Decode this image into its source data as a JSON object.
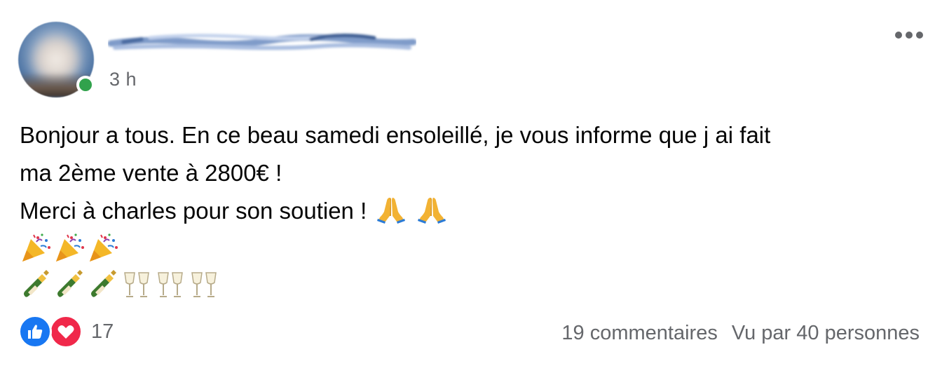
{
  "post": {
    "author": {
      "name_redacted": true,
      "online": true
    },
    "timestamp": "3 h",
    "more_icon": "more-horizontal-icon",
    "body": {
      "line1": "Bonjour a tous. En ce beau samedi ensoleillé, je vous informe que j ai fait",
      "line2": "ma 2ème vente à 2800€ !",
      "line3": "Merci à charles pour son soutien !",
      "line3_emojis": [
        "folded-hands-emoji",
        "folded-hands-emoji"
      ],
      "emoji_row1": [
        "party-popper-emoji",
        "party-popper-emoji",
        "party-popper-emoji"
      ],
      "emoji_row2": [
        "champagne-bottle-emoji",
        "champagne-bottle-emoji",
        "champagne-bottle-emoji",
        "clinking-glasses-emoji",
        "clinking-glasses-emoji",
        "clinking-glasses-emoji"
      ]
    },
    "footer": {
      "reactions": [
        "like-icon",
        "love-icon"
      ],
      "reaction_count": "17",
      "comments": "19 commentaires",
      "views": "Vu par 40 personnes"
    },
    "colors": {
      "like": "#1877f2",
      "love": "#f0284a",
      "online": "#31a24c",
      "secondary_text": "#65676b"
    }
  }
}
